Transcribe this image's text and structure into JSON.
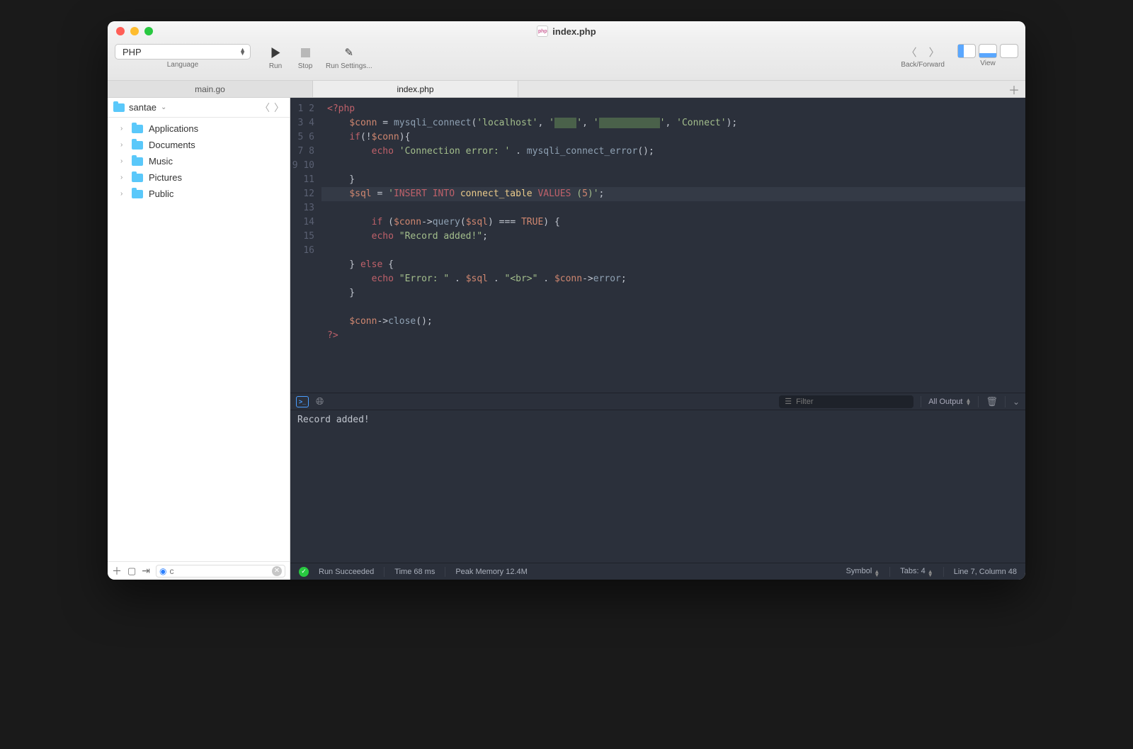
{
  "window": {
    "title": "index.php"
  },
  "toolbar": {
    "language": {
      "value": "PHP",
      "label": "Language"
    },
    "run": "Run",
    "stop": "Stop",
    "runSettings": "Run Settings...",
    "backForward": "Back/Forward",
    "view": "View"
  },
  "tabs": {
    "items": [
      "main.go",
      "index.php"
    ],
    "activeIndex": 1
  },
  "sidebar": {
    "crumb": "santae",
    "items": [
      "Applications",
      "Documents",
      "Music",
      "Pictures",
      "Public"
    ],
    "searchValue": "c"
  },
  "editor": {
    "lineCount": 16,
    "activeLine": 7,
    "lines": {
      "l1": {
        "open": "<?php"
      },
      "l2": {
        "var": "$conn",
        "fn": "mysqli_connect",
        "host": "'localhost'",
        "db": "'Connect'"
      },
      "l3": {
        "kw": "if",
        "var": "$conn"
      },
      "l4": {
        "kw": "echo",
        "s1": "'Connection error: '",
        "fn": "mysqli_connect_error"
      },
      "l7": {
        "var": "$sql",
        "s_a": "'",
        "kw1": "INSERT INTO",
        "id": " connect_table ",
        "kw2": "VALUES",
        "p": " (",
        "num": "5",
        "s_b": ")'"
      },
      "l8": {
        "kw": "if",
        "var1": "$conn",
        "m": "query",
        "var2": "$sql",
        "bool": "TRUE"
      },
      "l9": {
        "kw": "echo",
        "s": "\"Record added!\""
      },
      "l11": {
        "kw": "else"
      },
      "l12": {
        "kw": "echo",
        "s1": "\"Error: \"",
        "var1": "$sql",
        "s2": "\"<br>\"",
        "var2": "$conn",
        "m": "error"
      },
      "l15": {
        "var": "$conn",
        "m": "close"
      },
      "l16": {
        "close": "?>"
      }
    }
  },
  "console": {
    "filterPlaceholder": "Filter",
    "allOutput": "All Output",
    "output": "Record added!"
  },
  "status": {
    "runStatus": "Run Succeeded",
    "time": "Time 68 ms",
    "memory": "Peak Memory 12.4M",
    "symbol": "Symbol",
    "tabs": "Tabs: 4",
    "cursor": "Line 7, Column 48"
  }
}
